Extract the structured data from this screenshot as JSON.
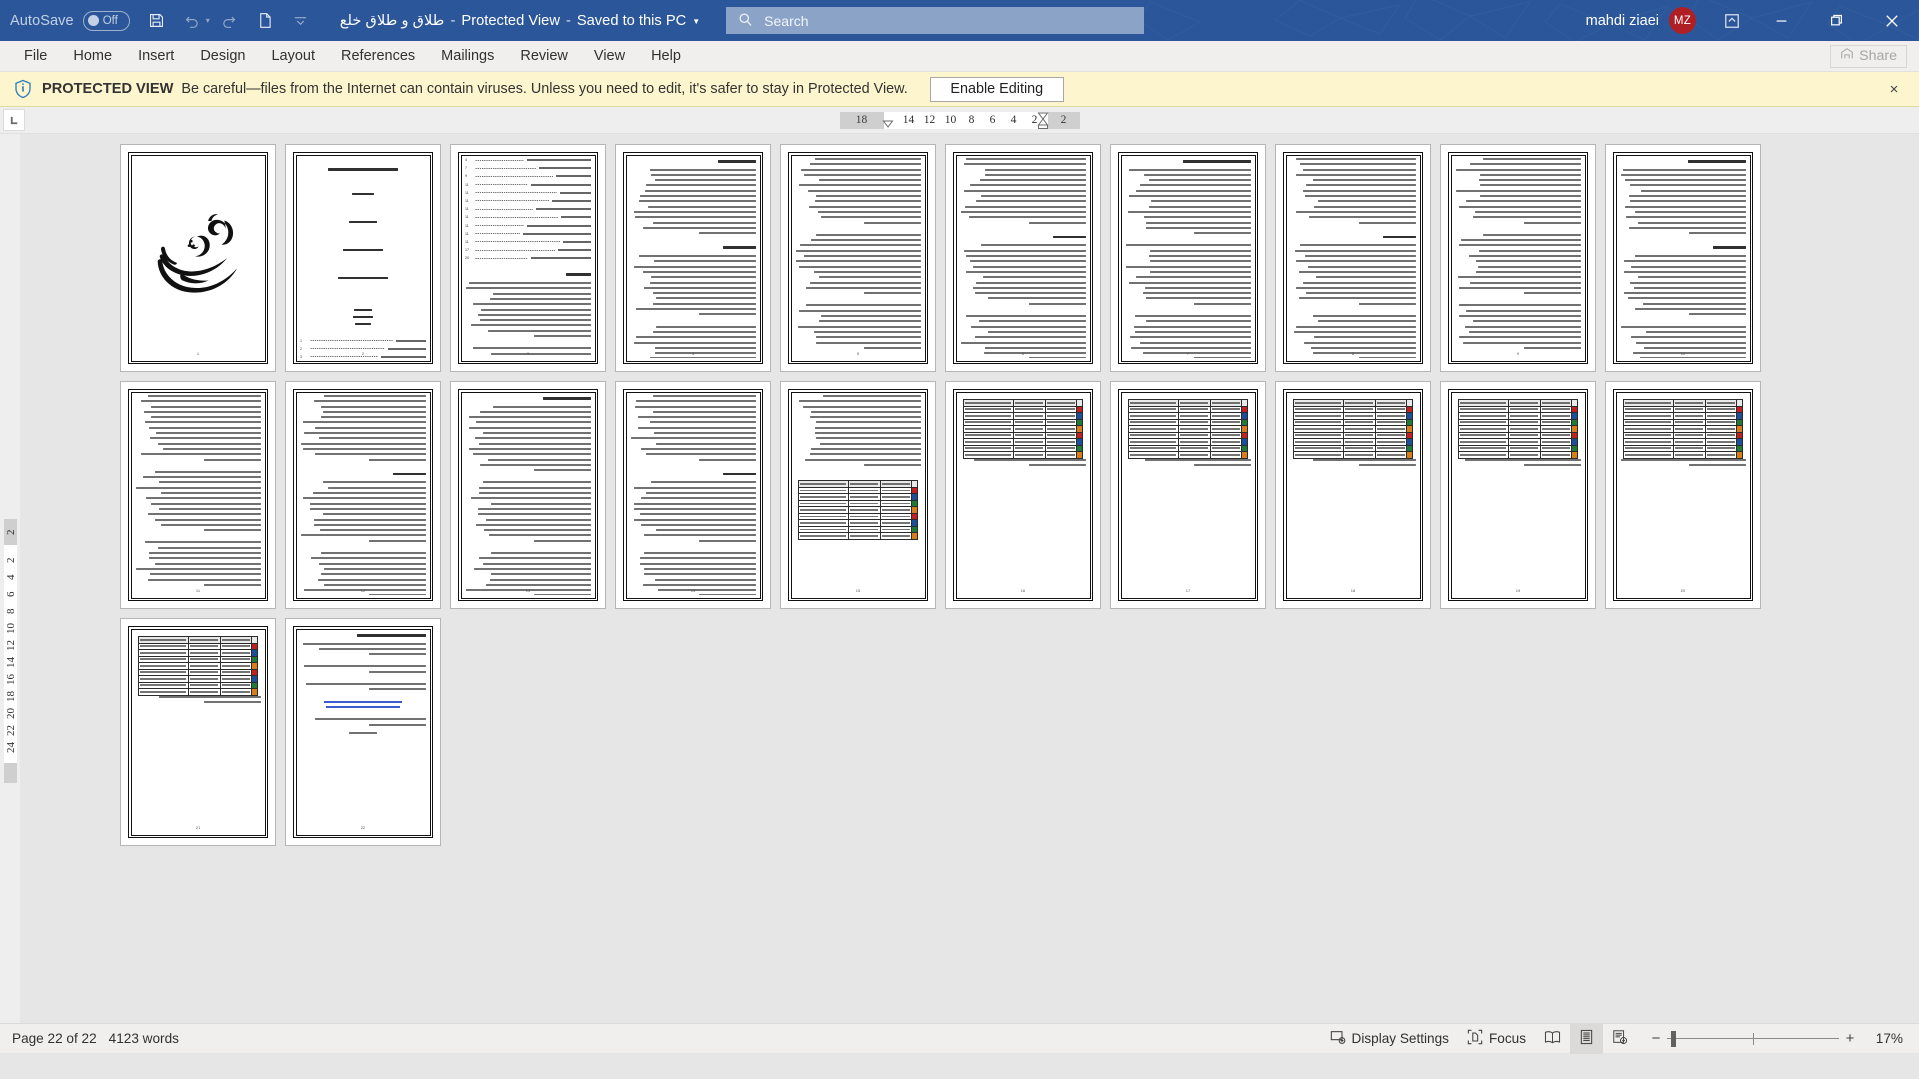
{
  "titlebar": {
    "autosave_label": "AutoSave",
    "autosave_state": "Off",
    "icons": [
      "save-icon",
      "undo-icon",
      "redo-icon",
      "new-doc-icon",
      "customize-quick-access-icon"
    ],
    "doc_title": "طلاق و طلاق خلع",
    "separator1": "-",
    "protected_view": "Protected View",
    "separator2": "-",
    "saved_state": "Saved to this PC",
    "search_placeholder": "Search",
    "user_name": "mahdi ziaei",
    "user_initials": "MZ",
    "ribbon_display_options": "ribbon-display-options-icon",
    "minimize": "minimize-icon",
    "restore": "restore-icon",
    "close": "close-icon"
  },
  "ribbon": {
    "tabs": [
      "File",
      "Home",
      "Insert",
      "Design",
      "Layout",
      "References",
      "Mailings",
      "Review",
      "View",
      "Help"
    ],
    "share_label": "Share"
  },
  "protected_view_bar": {
    "badge": "PROTECTED VIEW",
    "message": "Be careful—files from the Internet can contain viruses. Unless you need to edit, it's safer to stay in Protected View.",
    "enable_button": "Enable Editing",
    "close": "×"
  },
  "ruler": {
    "tab_selector": "L",
    "horizontal_left_margin_num": "18",
    "horizontal_numbers": [
      "14",
      "12",
      "10",
      "8",
      "6",
      "4",
      "2"
    ],
    "horizontal_right_margin_num": "2",
    "vertical_top_margin_num": "2",
    "vertical_numbers": [
      "2",
      "4",
      "6",
      "8",
      "10",
      "12",
      "14",
      "16",
      "18",
      "20",
      "22",
      "24"
    ]
  },
  "statusbar": {
    "page_info": "Page 22 of 22",
    "word_count": "4123 words",
    "display_settings": "Display Settings",
    "focus": "Focus",
    "view_read_mode": "read-mode-icon",
    "view_print_layout": "print-layout-icon",
    "view_web_layout": "web-layout-icon",
    "zoom_out": "−",
    "zoom_in": "+",
    "zoom_level": "17%"
  },
  "document": {
    "total_pages": 22,
    "pages_per_row": 10,
    "pages": [
      {
        "n": 1,
        "kind": "cover-bismillah",
        "label": "1"
      },
      {
        "n": 2,
        "kind": "title-page",
        "label": "2"
      },
      {
        "n": 3,
        "kind": "toc",
        "label": "3"
      },
      {
        "n": 4,
        "kind": "text",
        "label": "4"
      },
      {
        "n": 5,
        "kind": "text",
        "label": "5"
      },
      {
        "n": 6,
        "kind": "text",
        "label": "6"
      },
      {
        "n": 7,
        "kind": "text",
        "label": "7"
      },
      {
        "n": 8,
        "kind": "text",
        "label": "8"
      },
      {
        "n": 9,
        "kind": "text",
        "label": "9"
      },
      {
        "n": 10,
        "kind": "text",
        "label": "10"
      },
      {
        "n": 11,
        "kind": "text",
        "label": "11"
      },
      {
        "n": 12,
        "kind": "text",
        "label": "12"
      },
      {
        "n": 13,
        "kind": "text",
        "label": "13"
      },
      {
        "n": 14,
        "kind": "text",
        "label": "14"
      },
      {
        "n": 15,
        "kind": "text-table",
        "label": "15"
      },
      {
        "n": 16,
        "kind": "table",
        "label": "16"
      },
      {
        "n": 17,
        "kind": "table",
        "label": "17"
      },
      {
        "n": 18,
        "kind": "table",
        "label": "18"
      },
      {
        "n": 19,
        "kind": "table",
        "label": "19"
      },
      {
        "n": 20,
        "kind": "table",
        "label": "20"
      },
      {
        "n": 21,
        "kind": "table",
        "label": "21"
      },
      {
        "n": 22,
        "kind": "references",
        "label": "22"
      }
    ]
  }
}
